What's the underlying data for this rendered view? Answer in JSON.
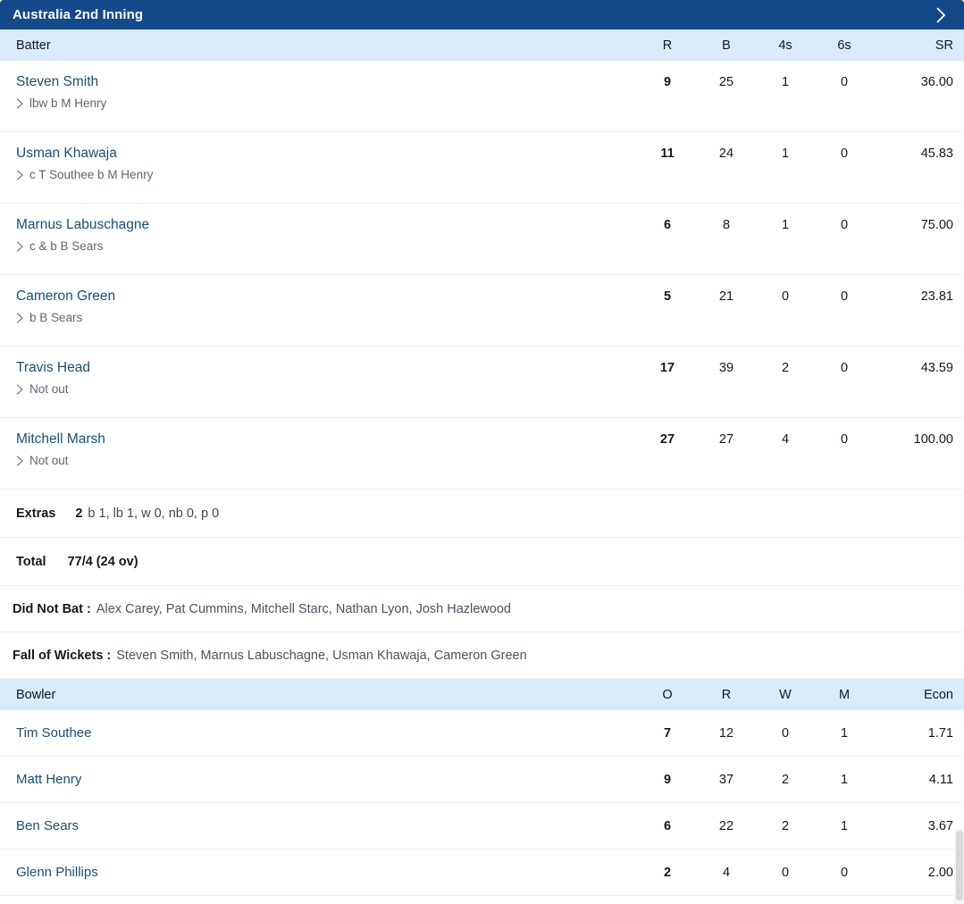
{
  "inning": {
    "title": "Australia 2nd Inning",
    "expand_icon": "chevron-right-icon",
    "header_color": "#144a8a"
  },
  "batting": {
    "columns": {
      "name": "Batter",
      "runs": "R",
      "balls": "B",
      "fours": "4s",
      "sixes": "6s",
      "strike_rate": "SR"
    },
    "rows": [
      {
        "name": "Steven Smith",
        "dismissal": "lbw b M Henry",
        "runs": "9",
        "balls": "25",
        "fours": "1",
        "sixes": "0",
        "strike_rate": "36.00"
      },
      {
        "name": "Usman Khawaja",
        "dismissal": "c T Southee b M Henry",
        "runs": "11",
        "balls": "24",
        "fours": "1",
        "sixes": "0",
        "strike_rate": "45.83"
      },
      {
        "name": "Marnus Labuschagne",
        "dismissal": "c & b B Sears",
        "runs": "6",
        "balls": "8",
        "fours": "1",
        "sixes": "0",
        "strike_rate": "75.00"
      },
      {
        "name": "Cameron Green",
        "dismissal": "b B Sears",
        "runs": "5",
        "balls": "21",
        "fours": "0",
        "sixes": "0",
        "strike_rate": "23.81"
      },
      {
        "name": "Travis Head",
        "dismissal": "Not out",
        "runs": "17",
        "balls": "39",
        "fours": "2",
        "sixes": "0",
        "strike_rate": "43.59"
      },
      {
        "name": "Mitchell Marsh",
        "dismissal": "Not out",
        "runs": "27",
        "balls": "27",
        "fours": "4",
        "sixes": "0",
        "strike_rate": "100.00"
      }
    ],
    "extras": {
      "label": "Extras",
      "value": "2",
      "breakdown": "b 1, lb 1, w 0, nb 0, p 0"
    },
    "total": {
      "label": "Total",
      "value": "77/4 (24 ov)"
    },
    "did_not_bat": {
      "label": "Did Not Bat :",
      "value": "Alex Carey, Pat Cummins, Mitchell Starc, Nathan Lyon, Josh Hazlewood"
    },
    "fall_of_wickets": {
      "label": "Fall of Wickets :",
      "value": "Steven Smith, Marnus Labuschagne, Usman Khawaja, Cameron Green"
    }
  },
  "bowling": {
    "columns": {
      "name": "Bowler",
      "overs": "O",
      "runs": "R",
      "wickets": "W",
      "maidens": "M",
      "economy": "Econ"
    },
    "rows": [
      {
        "name": "Tim Southee",
        "overs": "7",
        "runs": "12",
        "wickets": "0",
        "maidens": "1",
        "economy": "1.71"
      },
      {
        "name": "Matt Henry",
        "overs": "9",
        "runs": "37",
        "wickets": "2",
        "maidens": "1",
        "economy": "4.11"
      },
      {
        "name": "Ben Sears",
        "overs": "6",
        "runs": "22",
        "wickets": "2",
        "maidens": "1",
        "economy": "3.67"
      },
      {
        "name": "Glenn Phillips",
        "overs": "2",
        "runs": "4",
        "wickets": "0",
        "maidens": "0",
        "economy": "2.00"
      }
    ]
  }
}
